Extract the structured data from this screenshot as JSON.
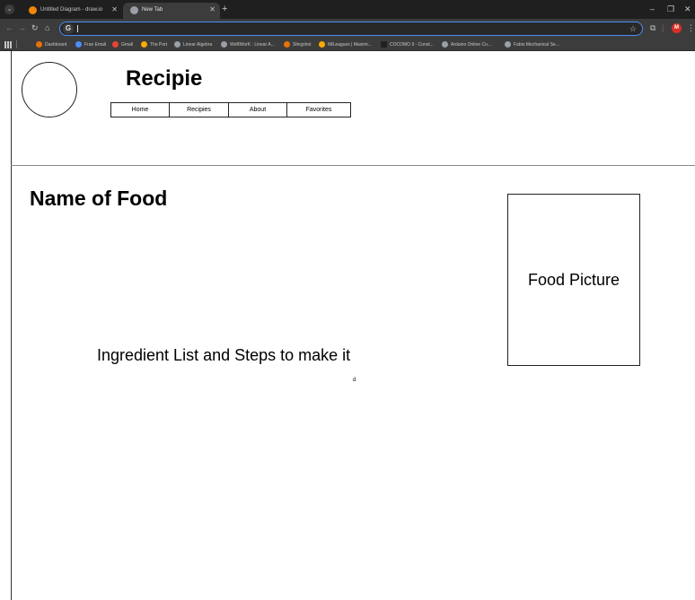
{
  "browser": {
    "tabs": [
      {
        "title": "Untitled Diagram - draw.io",
        "favicon": "drawio-icon"
      },
      {
        "title": "New Tab",
        "favicon": "globe-icon"
      }
    ],
    "new_tab_symbol": "+",
    "window_controls": {
      "minimize": "–",
      "restore": "❐",
      "close": "✕"
    },
    "profile_initial": "M",
    "omnibox_value": ""
  },
  "bookmarks": [
    {
      "label": "Dashboard",
      "color": "#e8710a"
    },
    {
      "label": "Fran Email",
      "color": "#4c8df6"
    },
    {
      "label": "Gmail",
      "color": "#ea4335"
    },
    {
      "label": "The Port",
      "color": "#f9ab00"
    },
    {
      "label": "Linear Algebra",
      "color": "#9aa0a6"
    },
    {
      "label": "WeBWorK : Linear A...",
      "color": "#9aa0a6"
    },
    {
      "label": "Slingshot",
      "color": "#e8710a"
    },
    {
      "label": "IMLeagues | Maximi...",
      "color": "#f9ab00"
    },
    {
      "label": "COCOMO II - Const...",
      "color": "#202124"
    },
    {
      "label": "Arduino Online Co...",
      "color": "#9aa0a6"
    },
    {
      "label": "Fabio Mechanical Se...",
      "color": "#9aa0a6"
    }
  ],
  "page": {
    "site_title": "Recipie",
    "nav": [
      "Home",
      "Recipies",
      "About",
      "Favorites"
    ],
    "food_name": "Name of Food",
    "food_picture_label": "Food Picture",
    "ingredients_label": "Ingredient List and Steps to make it",
    "stray_text": "d"
  }
}
